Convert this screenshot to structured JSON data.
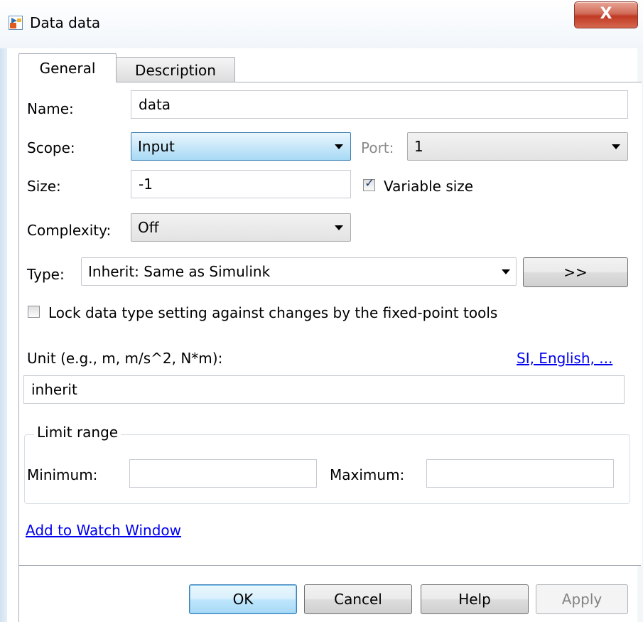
{
  "window": {
    "title": "Data data",
    "close_glyph": "X",
    "icon": "simulink-data-icon"
  },
  "tabs": [
    {
      "label": "General",
      "active": true
    },
    {
      "label": "Description",
      "active": false
    }
  ],
  "general": {
    "name_label": "Name:",
    "name_value": "data",
    "scope_label": "Scope:",
    "scope_value": "Input",
    "port_label": "Port:",
    "port_value": "1",
    "size_label": "Size:",
    "size_value": "-1",
    "variable_size_label": "Variable size",
    "variable_size_checked": true,
    "complexity_label": "Complexity:",
    "complexity_value": "Off",
    "type_label": "Type:",
    "type_value": "Inherit: Same as Simulink",
    "type_assistant_label": ">>",
    "lock_label": "Lock data type setting against changes by the fixed-point tools",
    "lock_checked": false,
    "unit_label": "Unit (e.g., m, m/s^2, N*m):",
    "unit_link": "SI, English, ...",
    "unit_value": "inherit",
    "limit_range_legend": "Limit range",
    "minimum_label": "Minimum:",
    "minimum_value": "",
    "maximum_label": "Maximum:",
    "maximum_value": "",
    "watch_link": "Add to Watch Window"
  },
  "buttons": {
    "ok": "OK",
    "cancel": "Cancel",
    "help": "Help",
    "apply": "Apply"
  }
}
